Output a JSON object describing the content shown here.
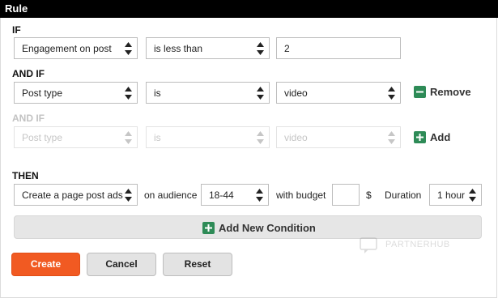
{
  "window": {
    "title": "Rule"
  },
  "if_section": {
    "label": "IF",
    "metric": "Engagement on post",
    "operator": "is less than",
    "value": "2"
  },
  "and_if_section": {
    "label": "AND IF",
    "field": "Post type",
    "operator": "is",
    "value": "video",
    "remove_label": "Remove"
  },
  "and_if_new": {
    "label": "AND IF",
    "field": "Post type",
    "operator": "is",
    "value": "video",
    "add_label": "Add"
  },
  "then_section": {
    "label": "THEN",
    "action": "Create a page post ads",
    "on_audience_label": "on audience",
    "audience": "18-44",
    "with_budget_label": "with budget",
    "budget_value": "",
    "currency": "$",
    "duration_label": "Duration",
    "duration": "1 hour"
  },
  "add_condition_label": "Add New Condition",
  "watermark_text": "PARTNERHUB",
  "buttons": {
    "create": "Create",
    "cancel": "Cancel",
    "reset": "Reset"
  },
  "colors": {
    "accent": "#f15a22",
    "add_icon": "#2e8b57",
    "disabled": "#c2c2c2"
  },
  "icons": {
    "select_arrows": "up-down-arrows-icon",
    "plus": "plus-icon",
    "minus": "minus-icon"
  }
}
